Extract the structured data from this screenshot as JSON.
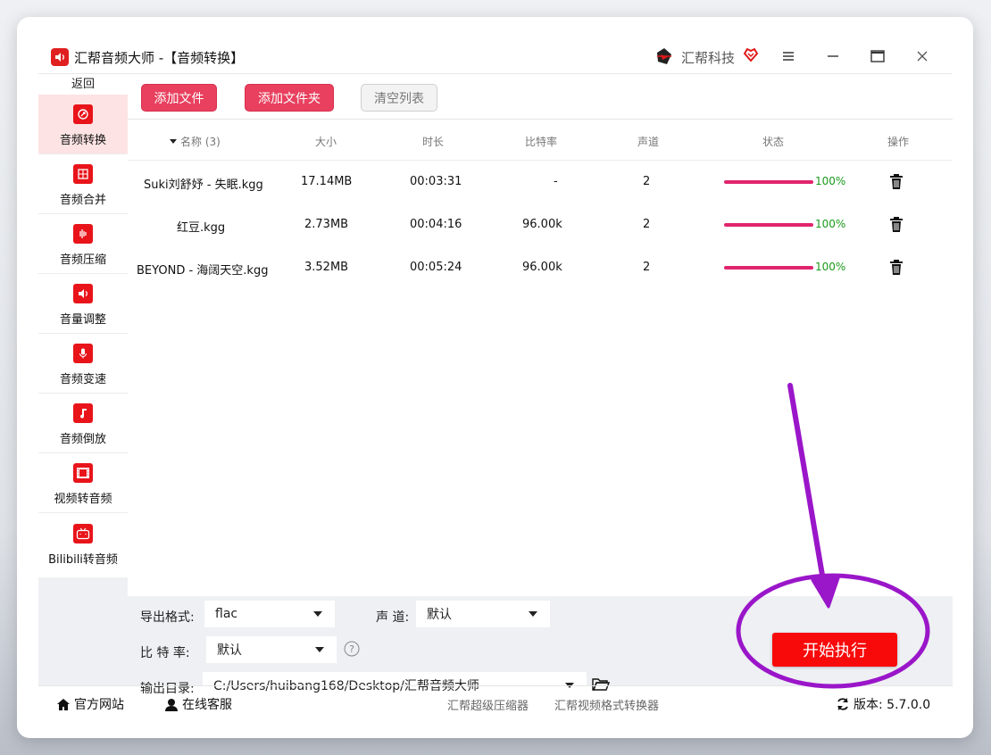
{
  "window": {
    "title": "汇帮音频大师  -【音频转换】",
    "brand": "汇帮科技"
  },
  "colors": {
    "accent": "#e8405e",
    "start_button": "#f80a0a",
    "progress": "#e0256e",
    "annotation": "#9a16c9",
    "success": "#1a9a1a"
  },
  "sidebar": {
    "back": "返回",
    "items": [
      {
        "label": "音频转换",
        "icon": "audio-convert-icon"
      },
      {
        "label": "音频合并",
        "icon": "audio-merge-icon"
      },
      {
        "label": "音频压缩",
        "icon": "audio-compress-icon"
      },
      {
        "label": "音量调整",
        "icon": "volume-icon"
      },
      {
        "label": "音频变速",
        "icon": "microphone-icon"
      },
      {
        "label": "音频倒放",
        "icon": "music-note-icon"
      },
      {
        "label": "视频转音频",
        "icon": "film-icon"
      },
      {
        "label": "Bilibili转音频",
        "icon": "tv-icon"
      }
    ]
  },
  "toolbar": {
    "add_file": "添加文件",
    "add_folder": "添加文件夹",
    "clear_list": "清空列表"
  },
  "table": {
    "columns": {
      "name": "名称 (3)",
      "size": "大小",
      "duration": "时长",
      "bitrate": "比特率",
      "channels": "声道",
      "status": "状态",
      "action": "操作"
    },
    "rows": [
      {
        "name": "Suki刘舒妤 - 失眠.kgg",
        "size": "17.14MB",
        "duration": "00:03:31",
        "bitrate": "-",
        "channels": "2",
        "progress": "100%"
      },
      {
        "name": "红豆.kgg",
        "size": "2.73MB",
        "duration": "00:04:16",
        "bitrate": "96.00k",
        "channels": "2",
        "progress": "100%"
      },
      {
        "name": "BEYOND - 海阔天空.kgg",
        "size": "3.52MB",
        "duration": "00:05:24",
        "bitrate": "96.00k",
        "channels": "2",
        "progress": "100%"
      }
    ]
  },
  "settings": {
    "format_label": "导出格式:",
    "format_value": "flac",
    "channel_label": "声 道:",
    "channel_value": "默认",
    "bitrate_label": "比 特 率:",
    "bitrate_value": "默认",
    "output_label": "输出目录:",
    "output_value": "C:/Users/huibang168/Desktop/汇帮音频大师",
    "start": "开始执行"
  },
  "footer": {
    "website": "官方网站",
    "support": "在线客服",
    "link1": "汇帮超级压缩器",
    "link2": "汇帮视频格式转换器",
    "version": "版本:  5.7.0.0"
  }
}
